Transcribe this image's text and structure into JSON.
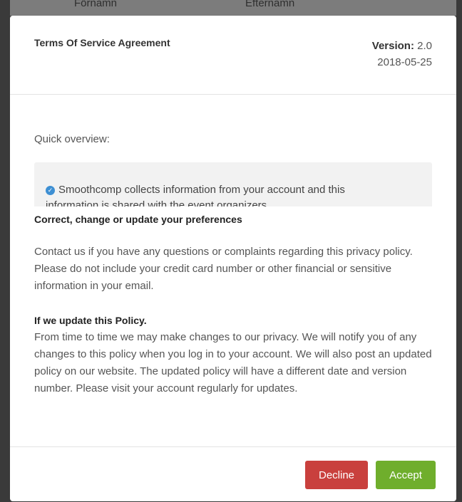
{
  "background": {
    "field_first_name": "Förnamn",
    "field_last_name": "Efternamn"
  },
  "tos_modal": {
    "title": "Terms Of Service Agreement",
    "version_label": "Version:",
    "version_value": "2.0",
    "version_date": "2018-05-25",
    "overview_label": "Quick overview:",
    "overview_item_line1": "Smoothcomp collects information from your account and this",
    "overview_item_line2": "information is shared with the event organizers"
  },
  "privacy_modal": {
    "section_heading": "Correct, change or update your preferences",
    "contact_paragraph": "Contact us if you have any questions or complaints regarding this privacy policy. Please do not include your credit card number or other financial or sensitive information in your email.",
    "update_heading": "If we update this Policy.",
    "update_paragraph": "From time to time we may make changes to our privacy. We will notify you of any changes to this policy when you log in to your account. We will also post an updated policy on our website. The updated policy will have a different date and version number. Please visit your account regularly for updates.",
    "decline_label": "Decline",
    "accept_label": "Accept"
  },
  "colors": {
    "decline": "#c9403d",
    "accept": "#6fae2c",
    "check_icon": "#3d8fd3"
  },
  "icons": {
    "overview_check": "check-circle-icon"
  }
}
